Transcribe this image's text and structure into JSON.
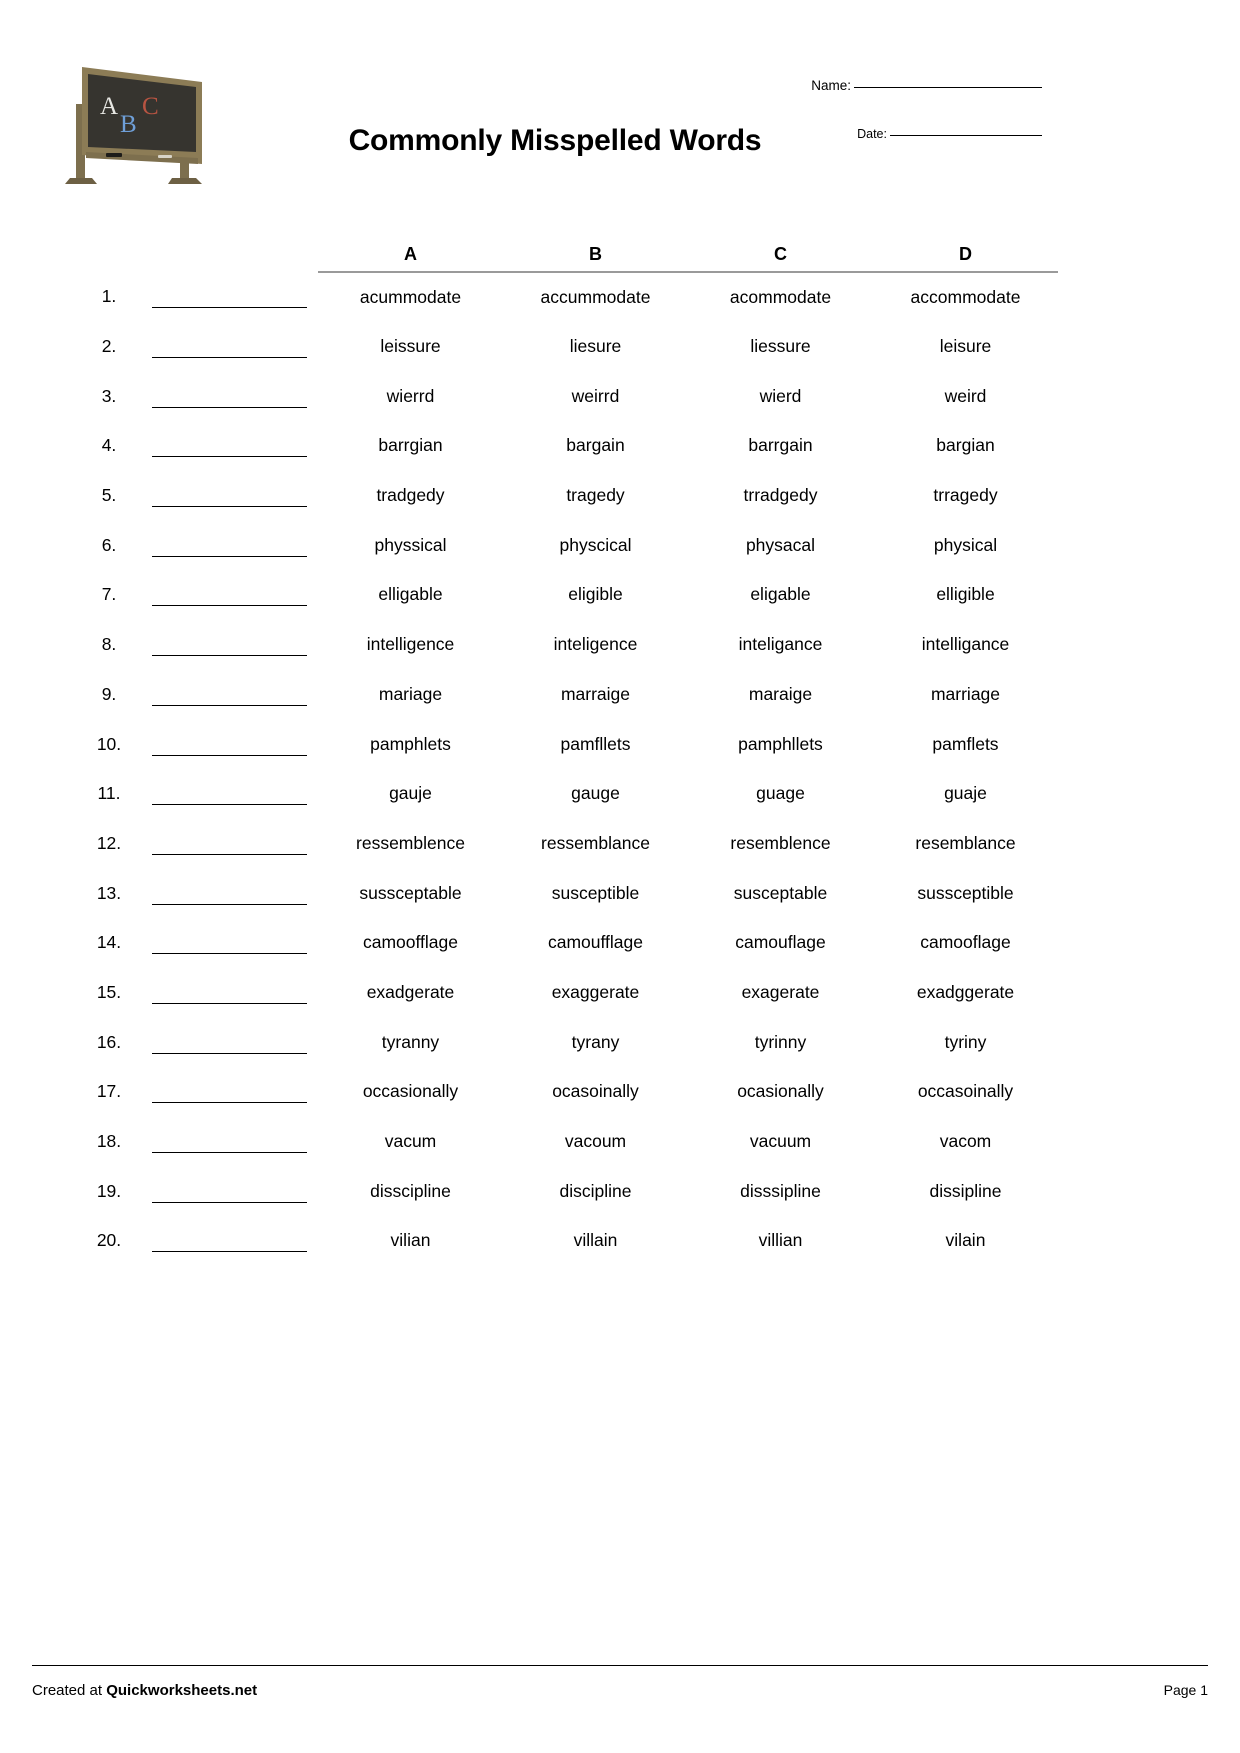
{
  "header": {
    "title": "Commonly Misspelled Words",
    "logo_icon": "chalkboard-abc-icon",
    "logo_letters": [
      "A",
      "B",
      "C"
    ],
    "name_label": "Name:",
    "name_value": "",
    "date_label": "Date:",
    "date_value": ""
  },
  "table": {
    "columns": [
      "A",
      "B",
      "C",
      "D"
    ],
    "answer_header": "",
    "number_header": "",
    "rows": [
      {
        "num": "1.",
        "answer": "",
        "options": [
          "acummodate",
          "accummodate",
          "acommodate",
          "accommodate"
        ]
      },
      {
        "num": "2.",
        "answer": "",
        "options": [
          "leissure",
          "liesure",
          "liessure",
          "leisure"
        ]
      },
      {
        "num": "3.",
        "answer": "",
        "options": [
          "wierrd",
          "weirrd",
          "wierd",
          "weird"
        ]
      },
      {
        "num": "4.",
        "answer": "",
        "options": [
          "barrgian",
          "bargain",
          "barrgain",
          "bargian"
        ]
      },
      {
        "num": "5.",
        "answer": "",
        "options": [
          "tradgedy",
          "tragedy",
          "trradgedy",
          "trragedy"
        ]
      },
      {
        "num": "6.",
        "answer": "",
        "options": [
          "physsical",
          "physcical",
          "physacal",
          "physical"
        ]
      },
      {
        "num": "7.",
        "answer": "",
        "options": [
          "elligable",
          "eligible",
          "eligable",
          "elligible"
        ]
      },
      {
        "num": "8.",
        "answer": "",
        "options": [
          "intelligence",
          "inteligence",
          "inteligance",
          "intelligance"
        ]
      },
      {
        "num": "9.",
        "answer": "",
        "options": [
          "mariage",
          "marraige",
          "maraige",
          "marriage"
        ]
      },
      {
        "num": "10.",
        "answer": "",
        "options": [
          "pamphlets",
          "pamfllets",
          "pamphllets",
          "pamflets"
        ]
      },
      {
        "num": "11.",
        "answer": "",
        "options": [
          "gauje",
          "gauge",
          "guage",
          "guaje"
        ]
      },
      {
        "num": "12.",
        "answer": "",
        "options": [
          "ressemblence",
          "ressemblance",
          "resemblence",
          "resemblance"
        ]
      },
      {
        "num": "13.",
        "answer": "",
        "options": [
          "sussceptable",
          "susceptible",
          "susceptable",
          "sussceptible"
        ]
      },
      {
        "num": "14.",
        "answer": "",
        "options": [
          "camoofflage",
          "camoufflage",
          "camouflage",
          "camooflage"
        ]
      },
      {
        "num": "15.",
        "answer": "",
        "options": [
          "exadgerate",
          "exaggerate",
          "exagerate",
          "exadggerate"
        ]
      },
      {
        "num": "16.",
        "answer": "",
        "options": [
          "tyranny",
          "tyrany",
          "tyrinny",
          "tyriny"
        ]
      },
      {
        "num": "17.",
        "answer": "",
        "options": [
          "occasionally",
          "ocasoinally",
          "ocasionally",
          "occasoinally"
        ]
      },
      {
        "num": "18.",
        "answer": "",
        "options": [
          "vacum",
          "vacoum",
          "vacuum",
          "vacom"
        ]
      },
      {
        "num": "19.",
        "answer": "",
        "options": [
          "disscipline",
          "discipline",
          "disssipline",
          "dissipline"
        ]
      },
      {
        "num": "20.",
        "answer": "",
        "options": [
          "vilian",
          "villain",
          "villian",
          "vilain"
        ]
      }
    ]
  },
  "footer": {
    "created_prefix": "Created at ",
    "created_brand": "Quickworksheets.net",
    "page_label": "Page 1"
  },
  "colors": {
    "text": "#000000",
    "header_rule": "#9a9a9a",
    "board_frame": "#7d6f4e",
    "board_surface": "#36342f",
    "chalk_a": "#e7e7e3",
    "chalk_b": "#6f9fd8",
    "chalk_c": "#b85442",
    "page_bg": "#ffffff"
  }
}
